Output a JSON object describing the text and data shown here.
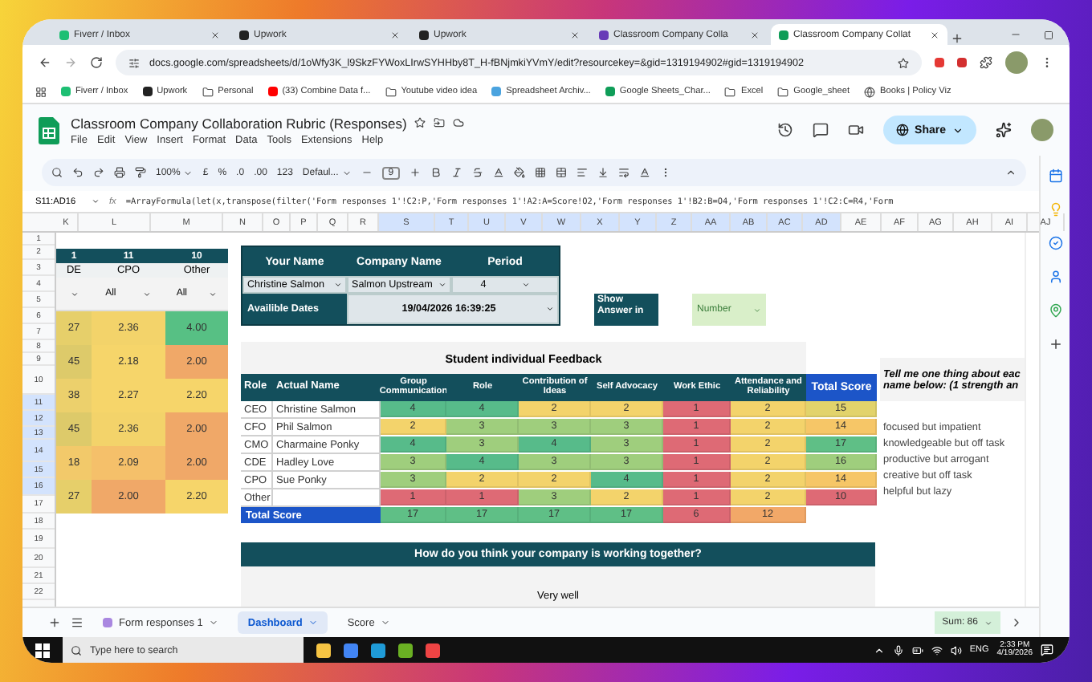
{
  "browser": {
    "tabs": [
      {
        "label": "Fiverr / Inbox",
        "kind": "fiverr",
        "selected": false
      },
      {
        "label": "Upwork",
        "kind": "upwork",
        "selected": false
      },
      {
        "label": "Upwork",
        "kind": "upwork",
        "selected": false
      },
      {
        "label": "Classroom Company Colla",
        "kind": "forms",
        "selected": false
      },
      {
        "label": "Classroom Company Collat",
        "kind": "sheets",
        "selected": true
      }
    ],
    "url": "docs.google.com/spreadsheets/d/1oWfy3K_l9SkzFYWoxLIrwSYHHby8T_H-fBNjmkiYVmY/edit?resourcekey=&gid=1319194902#gid=1319194902",
    "bookmarks": [
      {
        "label": "Fiverr / Inbox",
        "kind": "fiverr"
      },
      {
        "label": "Upwork",
        "kind": "upwork"
      },
      {
        "label": "Personal",
        "kind": "folder"
      },
      {
        "label": "(33) Combine Data f...",
        "kind": "video"
      },
      {
        "label": "Youtube video idea",
        "kind": "folder"
      },
      {
        "label": "Spreadsheet Archiv...",
        "kind": "page"
      },
      {
        "label": "Google Sheets_Char...",
        "kind": "sheets"
      },
      {
        "label": "Excel",
        "kind": "folder"
      },
      {
        "label": "Google_sheet",
        "kind": "folder"
      },
      {
        "label": "Books | Policy Viz",
        "kind": "globe"
      }
    ]
  },
  "doc": {
    "title": "Classroom Company Collaboration Rubric (Responses)",
    "menus": [
      "File",
      "Edit",
      "View",
      "Insert",
      "Format",
      "Data",
      "Tools",
      "Extensions",
      "Help"
    ],
    "share": "Share"
  },
  "toolbar": {
    "zoom": "100%",
    "currency": "£",
    "percent": "%",
    "decimal_less": ".0",
    "decimal_more": ".00",
    "number_format": "123",
    "font": "Defaul...",
    "font_size": "9"
  },
  "formula_bar": {
    "cell_ref": "S11:AD16",
    "fx": "fx",
    "formula": "=ArrayFormula(let(x,transpose(filter('Form responses 1'!C2:P,'Form responses 1'!A2:A=Score!O2,'Form responses 1'!B2:B=O4,'Form responses 1'!C2:C=R4,'Form"
  },
  "columns": [
    {
      "label": "K",
      "selected": false
    },
    {
      "label": "L",
      "selected": false
    },
    {
      "label": "M",
      "selected": false
    },
    {
      "label": "N",
      "selected": false
    },
    {
      "label": "O",
      "selected": false
    },
    {
      "label": "P",
      "selected": false
    },
    {
      "label": "Q",
      "selected": false
    },
    {
      "label": "R",
      "selected": false
    },
    {
      "label": "S",
      "selected": true
    },
    {
      "label": "T",
      "selected": true
    },
    {
      "label": "U",
      "selected": true
    },
    {
      "label": "V",
      "selected": true
    },
    {
      "label": "W",
      "selected": true
    },
    {
      "label": "X",
      "selected": true
    },
    {
      "label": "Y",
      "selected": true
    },
    {
      "label": "Z",
      "selected": true
    },
    {
      "label": "AA",
      "selected": true
    },
    {
      "label": "AB",
      "selected": true
    },
    {
      "label": "AC",
      "selected": true
    },
    {
      "label": "AD",
      "selected": true
    },
    {
      "label": "AE",
      "selected": false
    },
    {
      "label": "AF",
      "selected": false
    },
    {
      "label": "AG",
      "selected": false
    },
    {
      "label": "AH",
      "selected": false
    },
    {
      "label": "AI",
      "selected": false
    },
    {
      "label": "AJ",
      "selected": false
    }
  ],
  "rows": [
    {
      "label": "1",
      "selected": false
    },
    {
      "label": "2",
      "selected": false
    },
    {
      "label": "3",
      "selected": false
    },
    {
      "label": "4",
      "selected": false
    },
    {
      "label": "5",
      "selected": false
    },
    {
      "label": "6",
      "selected": false
    },
    {
      "label": "7",
      "selected": false
    },
    {
      "label": "8",
      "selected": false
    },
    {
      "label": "9",
      "selected": false
    },
    {
      "label": "10",
      "selected": false
    },
    {
      "label": "11",
      "selected": true
    },
    {
      "label": "12",
      "selected": true
    },
    {
      "label": "13",
      "selected": true
    },
    {
      "label": "14",
      "selected": true
    },
    {
      "label": "15",
      "selected": true
    },
    {
      "label": "16",
      "selected": true
    },
    {
      "label": "17",
      "selected": false
    },
    {
      "label": "18",
      "selected": false
    },
    {
      "label": "19",
      "selected": false
    },
    {
      "label": "20",
      "selected": false
    },
    {
      "label": "21",
      "selected": false
    },
    {
      "label": "22",
      "selected": false
    }
  ],
  "left_table": {
    "counts": [
      "1",
      "11",
      "10"
    ],
    "headers": [
      "DE",
      "CPO",
      "Other"
    ],
    "filters": [
      "All",
      "All"
    ],
    "rows": [
      {
        "cells": [
          {
            "value": "27",
            "color": "#e6cf6a"
          },
          {
            "value": "2.36",
            "color": "#f3d36a"
          },
          {
            "value": "4.00",
            "color": "#57c084"
          }
        ]
      },
      {
        "cells": [
          {
            "value": "45",
            "color": "#ddca6a"
          },
          {
            "value": "2.18",
            "color": "#f6d56a"
          },
          {
            "value": "2.00",
            "color": "#f0a868"
          }
        ]
      },
      {
        "cells": [
          {
            "value": "38",
            "color": "#ecd06c"
          },
          {
            "value": "2.27",
            "color": "#f6d56a"
          },
          {
            "value": "2.20",
            "color": "#f6d56a"
          }
        ]
      },
      {
        "cells": [
          {
            "value": "45",
            "color": "#ddca6a"
          },
          {
            "value": "2.36",
            "color": "#f3d36a"
          },
          {
            "value": "2.00",
            "color": "#f0a868"
          }
        ]
      },
      {
        "cells": [
          {
            "value": "18",
            "color": "#f2c96a"
          },
          {
            "value": "2.09",
            "color": "#f5c06a"
          },
          {
            "value": "2.00",
            "color": "#f0a868"
          }
        ]
      },
      {
        "cells": [
          {
            "value": "27",
            "color": "#e6cf6a"
          },
          {
            "value": "2.00",
            "color": "#f0a868"
          },
          {
            "value": "2.20",
            "color": "#f6d56a"
          }
        ]
      }
    ]
  },
  "info": {
    "headers": [
      "Your Name",
      "Company Name",
      "Period"
    ],
    "values": [
      "Christine Salmon",
      "Salmon Upstream",
      "4"
    ],
    "dates_label": "Availible Dates",
    "date": "19/04/2026 16:39:25",
    "show_label": "Show Answer in",
    "show_value": "Number"
  },
  "feedback": {
    "title": "Student individual Feedback",
    "columns": [
      "Role",
      "Actual Name",
      "Group Communication",
      "Role",
      "Contribution of Ideas",
      "Self Advocacy",
      "Work Ethic",
      "Attendance and Reliability",
      "Total Score"
    ],
    "rows": [
      {
        "role": "CEO",
        "name": "Christine Salmon",
        "scores": [
          {
            "value": "4",
            "color": "#57bb8a"
          },
          {
            "value": "4",
            "color": "#57bb8a"
          },
          {
            "value": "2",
            "color": "#f3d36b"
          },
          {
            "value": "2",
            "color": "#f3d36b"
          },
          {
            "value": "1",
            "color": "#de6a75"
          },
          {
            "value": "2",
            "color": "#f3d36b"
          }
        ],
        "total": {
          "value": "15",
          "color": "#e2d36b"
        }
      },
      {
        "role": "CFO",
        "name": "Phil Salmon",
        "scores": [
          {
            "value": "2",
            "color": "#f3d36b"
          },
          {
            "value": "3",
            "color": "#9fce7d"
          },
          {
            "value": "3",
            "color": "#9fce7d"
          },
          {
            "value": "3",
            "color": "#9fce7d"
          },
          {
            "value": "1",
            "color": "#de6a75"
          },
          {
            "value": "2",
            "color": "#f3d36b"
          }
        ],
        "total": {
          "value": "14",
          "color": "#f6c667"
        }
      },
      {
        "role": "CMO",
        "name": "Charmaine Ponky",
        "scores": [
          {
            "value": "4",
            "color": "#57bb8a"
          },
          {
            "value": "3",
            "color": "#9fce7d"
          },
          {
            "value": "4",
            "color": "#57bb8a"
          },
          {
            "value": "3",
            "color": "#9fce7d"
          },
          {
            "value": "1",
            "color": "#de6a75"
          },
          {
            "value": "2",
            "color": "#f3d36b"
          }
        ],
        "total": {
          "value": "17",
          "color": "#5fbf86"
        }
      },
      {
        "role": "CDE",
        "name": "Hadley Love",
        "scores": [
          {
            "value": "3",
            "color": "#9fce7d"
          },
          {
            "value": "4",
            "color": "#57bb8a"
          },
          {
            "value": "3",
            "color": "#9fce7d"
          },
          {
            "value": "3",
            "color": "#9fce7d"
          },
          {
            "value": "1",
            "color": "#de6a75"
          },
          {
            "value": "2",
            "color": "#f3d36b"
          }
        ],
        "total": {
          "value": "16",
          "color": "#9fce7d"
        }
      },
      {
        "role": "CPO",
        "name": "Sue Ponky",
        "scores": [
          {
            "value": "3",
            "color": "#9fce7d"
          },
          {
            "value": "2",
            "color": "#f3d36b"
          },
          {
            "value": "2",
            "color": "#f3d36b"
          },
          {
            "value": "4",
            "color": "#57bb8a"
          },
          {
            "value": "1",
            "color": "#de6a75"
          },
          {
            "value": "2",
            "color": "#f3d36b"
          }
        ],
        "total": {
          "value": "14",
          "color": "#f6c667"
        }
      },
      {
        "role": "Other",
        "scores": [
          {
            "value": "1",
            "color": "#de6a75"
          },
          {
            "value": "1",
            "color": "#de6a75"
          },
          {
            "value": "3",
            "color": "#9fce7d"
          },
          {
            "value": "2",
            "color": "#f3d36b"
          },
          {
            "value": "1",
            "color": "#de6a75"
          },
          {
            "value": "2",
            "color": "#f3d36b"
          }
        ],
        "total": {
          "value": "10",
          "color": "#de6a75"
        }
      }
    ],
    "total_row": {
      "label": "Total Score",
      "scores": [
        {
          "value": "17",
          "color": "#5fbf86"
        },
        {
          "value": "17",
          "color": "#5fbf86"
        },
        {
          "value": "17",
          "color": "#5fbf86"
        },
        {
          "value": "17",
          "color": "#5fbf86"
        },
        {
          "value": "6",
          "color": "#de6a75"
        },
        {
          "value": "12",
          "color": "#f2a868"
        }
      ]
    }
  },
  "answers": {
    "question_lines": [
      "Tell me one thing about eac",
      "name below: (1 strength an"
    ],
    "items": [
      "focused but impatient",
      "knowledgeable but off task",
      "productive but arrogant",
      "creative but off task",
      "helpful but lazy"
    ]
  },
  "banner": {
    "question": "How do you think your company is working together?",
    "answer": "Very well"
  },
  "sheet_tabs": [
    {
      "label": "Form responses 1",
      "kind": "form",
      "selected": false
    },
    {
      "label": "Dashboard",
      "kind": "plain",
      "selected": true
    },
    {
      "label": "Score",
      "kind": "plain",
      "selected": false
    }
  ],
  "sum": "Sum: 86",
  "taskbar": {
    "search": "Type here to search",
    "language": "ENG",
    "time": "2:33 PM",
    "date": "4/19/2026"
  }
}
